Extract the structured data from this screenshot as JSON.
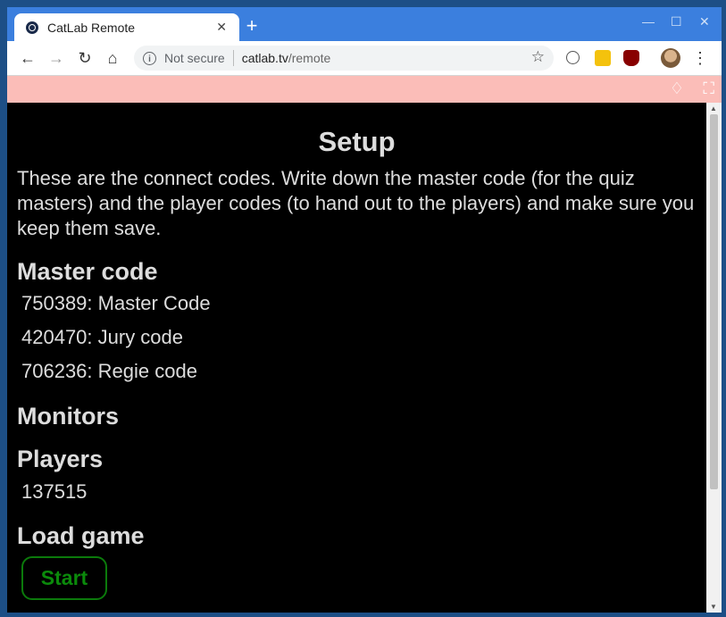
{
  "browser": {
    "tab_title": "CatLab Remote",
    "new_tab": "+",
    "security_label": "Not secure",
    "url_host": "catlab.tv",
    "url_path": "/remote",
    "icons": {
      "close": "close-icon",
      "back": "back-arrow-icon",
      "forward": "forward-arrow-icon",
      "reload": "reload-icon",
      "home": "home-icon",
      "bookmark": "star-icon",
      "menu": "kebab-menu-icon"
    }
  },
  "page": {
    "title": "Setup",
    "intro": "These are the connect codes. Write down the master code (for the quiz masters) and the player codes (to hand out to the players) and make sure you keep them save.",
    "master_heading": "Master code",
    "codes": [
      "750389: Master Code",
      "420470: Jury code",
      "706236: Regie code"
    ],
    "monitors_heading": "Monitors",
    "players_heading": "Players",
    "player_code": "137515",
    "load_heading": "Load game",
    "start_label": "Start"
  },
  "colors": {
    "accent_pink": "#fbbdb8",
    "start_green": "#0b8a0b",
    "background": "#000000"
  }
}
